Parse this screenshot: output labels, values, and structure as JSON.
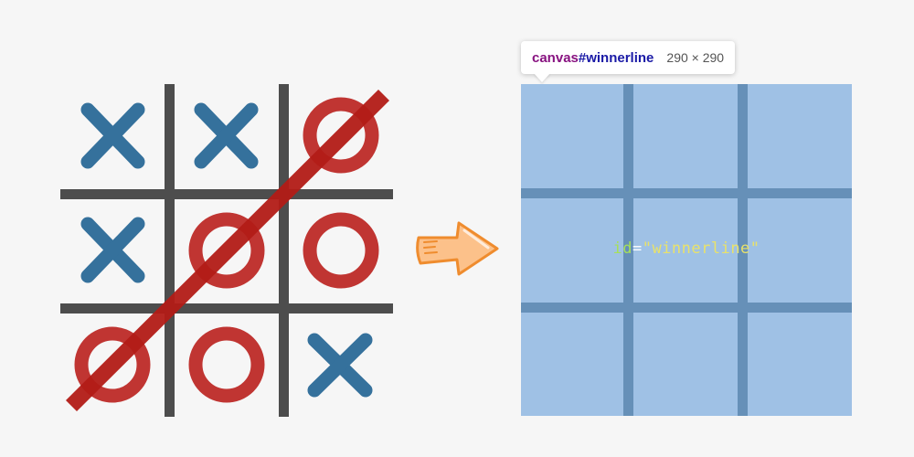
{
  "board": {
    "cells": [
      "X",
      "X",
      "O",
      "X",
      "O",
      "O",
      "O",
      "O",
      "X"
    ],
    "winning_line": "diagonal from top-right to bottom-left",
    "colors": {
      "x": "#2f6d9a",
      "o": "#c03532",
      "grid": "#4d4d4d",
      "strike": "#b31c17"
    }
  },
  "arrow": {
    "icon": "hand-drawn-right-arrow-icon",
    "color": "#f7a04a"
  },
  "devtools": {
    "tag": "canvas",
    "hash": "#",
    "id": "winnerline",
    "size": "290 × 290",
    "highlight_color": "#9fc1e5",
    "attr_name": "id",
    "attr_eq": "=",
    "attr_value": "\"winnerline\""
  }
}
